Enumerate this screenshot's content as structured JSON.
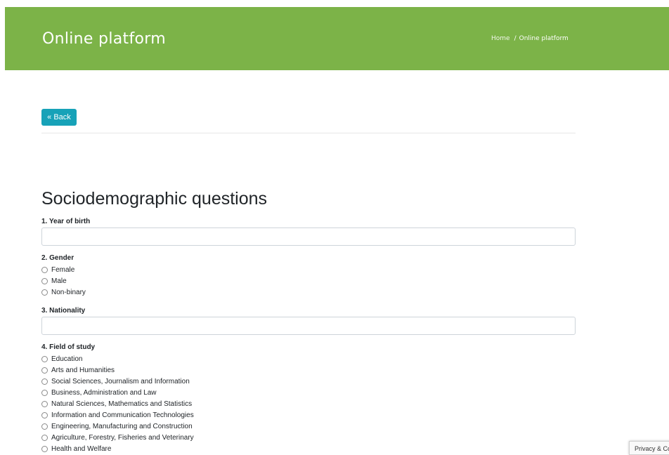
{
  "header": {
    "title": "Online platform",
    "breadcrumb_home": "Home",
    "breadcrumb_separator": "/",
    "breadcrumb_current": "Online platform",
    "background_color": "#7cb348"
  },
  "back_button": {
    "label": "« Back",
    "color": "#17a2b8"
  },
  "section_title": "Sociodemographic questions",
  "questions": {
    "q1": {
      "label": "1. Year of birth",
      "value": ""
    },
    "q2": {
      "label": "2. Gender",
      "options": [
        "Female",
        "Male",
        "Non-binary"
      ]
    },
    "q3": {
      "label": "3. Nationality",
      "value": ""
    },
    "q4": {
      "label": "4. Field of study",
      "options": [
        "Education",
        "Arts and Humanities",
        "Social Sciences, Journalism and Information",
        "Business, Administration and Law",
        "Natural Sciences, Mathematics and Statistics",
        "Information and Communication Technologies",
        "Engineering, Manufacturing and Construction",
        "Agriculture, Forestry, Fisheries and Veterinary",
        "Health and Welfare"
      ]
    }
  },
  "privacy_badge": {
    "label": "Privacy & Co"
  }
}
